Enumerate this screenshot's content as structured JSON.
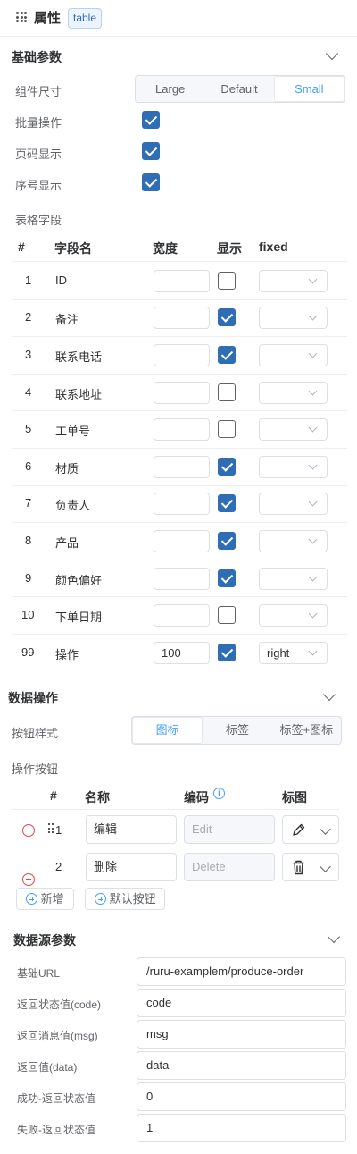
{
  "header": {
    "title": "属性",
    "tag": "table"
  },
  "basic": {
    "section_title": "基础参数",
    "size_label": "组件尺寸",
    "size_options": [
      "Large",
      "Default",
      "Small"
    ],
    "batch_label": "批量操作",
    "pager_label": "页码显示",
    "index_label": "序号显示",
    "fields_label": "表格字段"
  },
  "fields_table": {
    "headers": {
      "num": "#",
      "name": "字段名",
      "width": "宽度",
      "show": "显示",
      "fixed": "fixed"
    },
    "rows": [
      {
        "num": "1",
        "name": "ID",
        "width": "",
        "show": false,
        "fixed": ""
      },
      {
        "num": "2",
        "name": "备注",
        "width": "",
        "show": true,
        "fixed": ""
      },
      {
        "num": "3",
        "name": "联系电话",
        "width": "",
        "show": true,
        "fixed": ""
      },
      {
        "num": "4",
        "name": "联系地址",
        "width": "",
        "show": false,
        "fixed": ""
      },
      {
        "num": "5",
        "name": "工单号",
        "width": "",
        "show": false,
        "fixed": ""
      },
      {
        "num": "6",
        "name": "材质",
        "width": "",
        "show": true,
        "fixed": ""
      },
      {
        "num": "7",
        "name": "负责人",
        "width": "",
        "show": true,
        "fixed": ""
      },
      {
        "num": "8",
        "name": "产品",
        "width": "",
        "show": true,
        "fixed": ""
      },
      {
        "num": "9",
        "name": "颜色偏好",
        "width": "",
        "show": true,
        "fixed": ""
      },
      {
        "num": "10",
        "name": "下单日期",
        "width": "",
        "show": false,
        "fixed": ""
      },
      {
        "num": "99",
        "name": "操作",
        "width": "100",
        "show": true,
        "fixed": "right"
      }
    ]
  },
  "data_ops": {
    "section_title": "数据操作",
    "style_label": "按钮样式",
    "style_options": [
      "图标",
      "标签",
      "标签+图标"
    ],
    "buttons_label": "操作按钮",
    "headers": {
      "num": "#",
      "name": "名称",
      "code": "编码",
      "icon": "标图"
    },
    "rows": [
      {
        "num": "1",
        "name": "编辑",
        "code_placeholder": "Edit",
        "icon": "pencil-icon"
      },
      {
        "num": "2",
        "name": "删除",
        "code_placeholder": "Delete",
        "icon": "trash-icon"
      }
    ],
    "add_label": "新增",
    "default_label": "默认按钮"
  },
  "datasource": {
    "section_title": "数据源参数",
    "fields": [
      {
        "label": "基础URL",
        "value": "/ruru-examplem/produce-order"
      },
      {
        "label": "返回状态值(code)",
        "value": "code"
      },
      {
        "label": "返回消息值(msg)",
        "value": "msg"
      },
      {
        "label": "返回值(data)",
        "value": "data"
      },
      {
        "label": "成功-返回状态值",
        "value": "0"
      },
      {
        "label": "失败-返回状态值",
        "value": "1"
      }
    ]
  },
  "colors": {
    "accent": "#409eff",
    "checkbox": "#2f6db5",
    "danger": "#e0484a"
  }
}
